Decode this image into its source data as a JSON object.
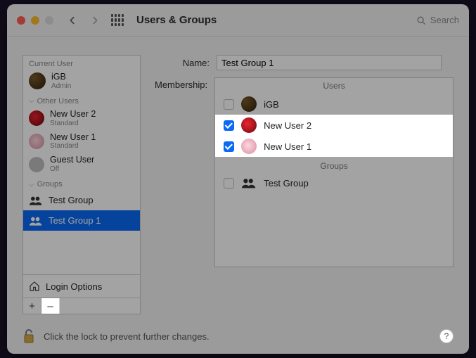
{
  "window": {
    "title": "Users & Groups",
    "search_placeholder": "Search"
  },
  "sidebar": {
    "current_label": "Current User",
    "current": {
      "name": "iGB",
      "role": "Admin"
    },
    "other_label": "Other Users",
    "others": [
      {
        "name": "New User 2",
        "role": "Standard"
      },
      {
        "name": "New User 1",
        "role": "Standard"
      },
      {
        "name": "Guest User",
        "role": "Off"
      }
    ],
    "groups_label": "Groups",
    "groups": [
      {
        "name": "Test Group"
      },
      {
        "name": "Test Group 1"
      }
    ],
    "login_options": "Login Options",
    "add": "+",
    "remove": "–"
  },
  "form": {
    "name_label": "Name:",
    "name_value": "Test Group 1",
    "membership_label": "Membership:",
    "users_header": "Users",
    "groups_header": "Groups",
    "users": [
      {
        "name": "iGB",
        "checked": false
      },
      {
        "name": "New User 2",
        "checked": true
      },
      {
        "name": "New User 1",
        "checked": true
      }
    ],
    "groups": [
      {
        "name": "Test Group",
        "checked": false
      }
    ]
  },
  "lock": {
    "text": "Click the lock to prevent further changes.",
    "help": "?"
  }
}
